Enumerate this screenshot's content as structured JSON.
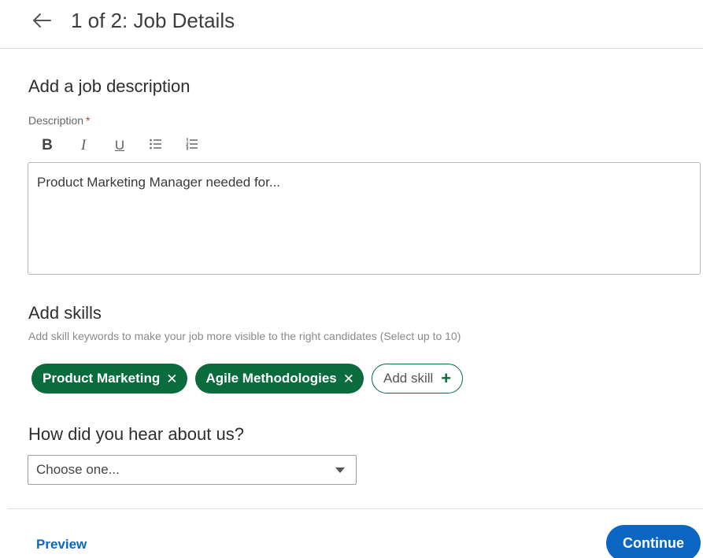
{
  "header": {
    "back_icon": "arrow-left-icon",
    "title": "1 of 2: Job Details"
  },
  "description_section": {
    "title": "Add a job description",
    "field_label": "Description",
    "required_marker": "*",
    "toolbar": {
      "bold": "B",
      "italic": "I",
      "underline": "U",
      "bulleted_list_icon": "bulleted-list-icon",
      "numbered_list_icon": "numbered-list-icon"
    },
    "value": "Product Marketing Manager needed for..."
  },
  "skills_section": {
    "title": "Add skills",
    "subtitle": "Add skill keywords to make your job more visible to the right candidates (Select up to 10)",
    "skills": [
      {
        "label": "Product Marketing",
        "remove": "✕"
      },
      {
        "label": "Agile Methodologies",
        "remove": "✕"
      }
    ],
    "add_skill_label": "Add skill",
    "add_skill_icon": "+"
  },
  "source_section": {
    "title": "How did you hear about us?",
    "selected": "Choose one..."
  },
  "footer": {
    "preview_label": "Preview",
    "continue_label": "Continue"
  },
  "colors": {
    "chip_green": "#0a6b3d",
    "primary_blue": "#0a66c2"
  }
}
